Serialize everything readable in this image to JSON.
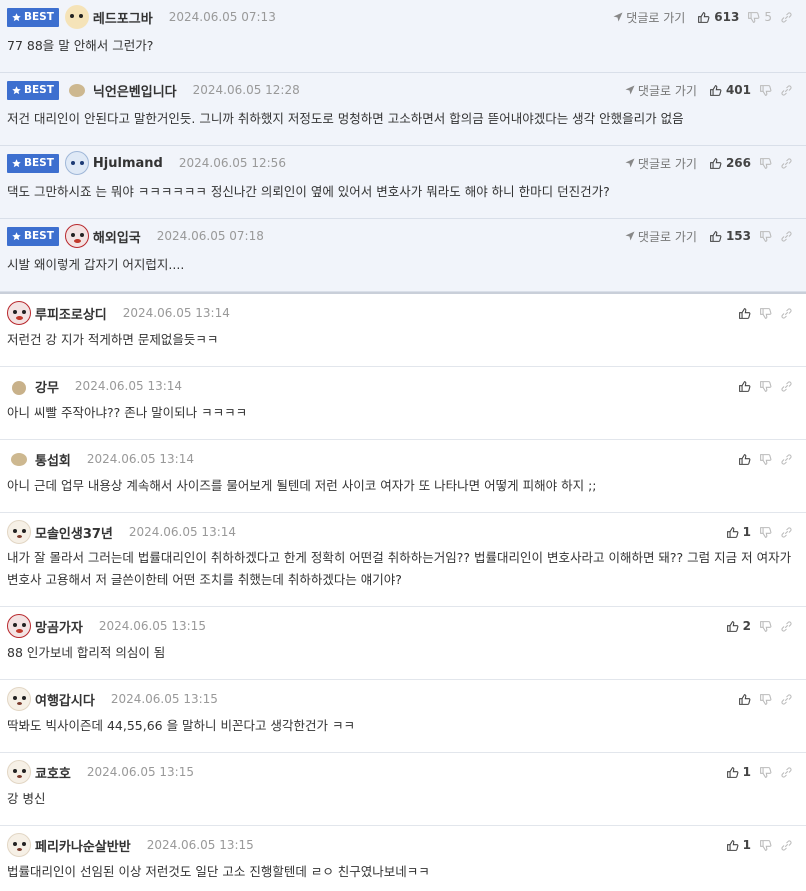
{
  "best_label": "BEST",
  "reply_label": "댓글로 가기",
  "best_comments": [
    {
      "nick": "레드포그바",
      "date": "2024.06.05 07:13",
      "text": "77 88을 말 안해서 그런가?",
      "up": "613",
      "down": "5",
      "avatar": "fox"
    },
    {
      "nick": "닉언은벤입니다",
      "date": "2024.06.05 12:28",
      "text": "저건 대리인이 안된다고 말한거인듯. 그니까 취하했지 저정도로 멍청하면 고소하면서 합의금 뜯어내야겠다는 생각 안했을리가 없음",
      "up": "401",
      "down": "",
      "avatar": "blob"
    },
    {
      "nick": "Hjulmand",
      "date": "2024.06.05 12:56",
      "text": "댁도 그만하시죠 는 뭐야 ㅋㅋㅋㅋㅋㅋ 정신나간 의뢰인이 옆에 있어서 변호사가 뭐라도 해야 하니 한마디 던진건가?",
      "up": "266",
      "down": "",
      "avatar": "blue"
    },
    {
      "nick": "해외입국",
      "date": "2024.06.05 07:18",
      "text": "시발 왜이렇게 갑자기 어지럽지....",
      "up": "153",
      "down": "",
      "avatar": "red"
    }
  ],
  "comments": [
    {
      "nick": "루피조로상디",
      "date": "2024.06.05 13:14",
      "text": "저런건 강 지가 적게하면 문제없을듯ㅋㅋ",
      "up": "",
      "avatar": "red"
    },
    {
      "nick": "강무",
      "date": "2024.06.05 13:14",
      "text": "아니 씨빨 주작아냐?? 존나 말이되나 ㅋㅋㅋㅋ",
      "up": "",
      "avatar": "blob-small"
    },
    {
      "nick": "통섭회",
      "date": "2024.06.05 13:14",
      "text": "아니 근데 업무 내용상 계속해서 사이즈를 물어보게 될텐데 저런 사이코 여자가 또 나타나면 어떻게 피해야 하지 ;;",
      "up": "",
      "avatar": "blob"
    },
    {
      "nick": "모솔인생37년",
      "date": "2024.06.05 13:14",
      "text": "내가 잘 몰라서 그러는데 법률대리인이 취하하겠다고 한게 정확히 어떤걸 취하하는거임?? 법률대리인이 변호사라고 이해하면 돼?? 그럼 지금 저 여자가 변호사 고용해서 저 글쓴이한테 어떤 조치를 취했는데 취하하겠다는 얘기야?",
      "up": "1",
      "avatar": "dog"
    },
    {
      "nick": "망곰가자",
      "date": "2024.06.05 13:15",
      "text": "88 인가보네 합리적 의심이 됨",
      "up": "2",
      "avatar": "red"
    },
    {
      "nick": "여행갑시다",
      "date": "2024.06.05 13:15",
      "text": "딱봐도 빅사이즌데 44,55,66 을 말하니 비꼰다고 생각한건가 ㅋㅋ",
      "up": "",
      "avatar": "dog"
    },
    {
      "nick": "쿄호호",
      "date": "2024.06.05 13:15",
      "text": "강 병신",
      "up": "1",
      "avatar": "dog"
    },
    {
      "nick": "페리카나순살반반",
      "date": "2024.06.05 13:15",
      "text": "법률대리인이 선임된 이상 저런것도 일단 고소 진행할텐데 ㄹㅇ 친구였나보네ㅋㅋ",
      "up": "1",
      "avatar": "dog"
    }
  ]
}
